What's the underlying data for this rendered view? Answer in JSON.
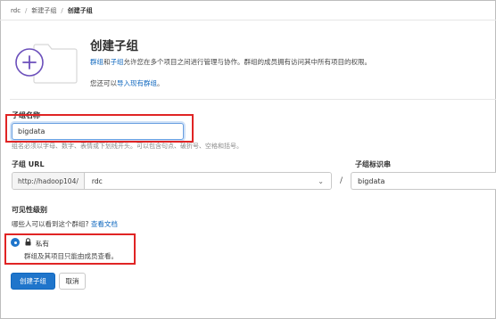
{
  "breadcrumb": {
    "items": [
      "rdc",
      "新建子组",
      "创建子组"
    ]
  },
  "header": {
    "title": "创建子组",
    "description_link1": "群组",
    "description_and": "和",
    "description_link2": "子组",
    "description_rest": "允许您在多个项目之间进行管理与协作。群组的成员拥有访问其中所有项目的权限。",
    "import_prefix": "您还可以",
    "import_link": "导入现有群组",
    "import_suffix": "。"
  },
  "form": {
    "name_label": "子组名称",
    "name_value": "bigdata",
    "name_hint": "组名必须以字母、数字、表情或下划线开头。可以包含句点、破折号、空格和括号。",
    "url_label": "子组 URL",
    "url_prefix": "http://hadoop104/",
    "url_parent": "rdc",
    "slash": "/",
    "slug_label": "子组标识串",
    "slug_value": "bigdata",
    "visibility_label": "可见性级别",
    "visibility_question": "哪些人可以看到这个群组?",
    "help_link": "查看文档",
    "private_label": "私有",
    "private_desc": "群组及其项目只能由成员查看。"
  },
  "actions": {
    "create_label": "创建子组",
    "cancel_label": "取消"
  },
  "icons": {
    "chevron": "chevron-down-icon",
    "lock": "lock-icon",
    "illustration": "folder-plus-illustration"
  },
  "colors": {
    "primary": "#1f75cb",
    "link": "#1068bf",
    "annotation": "#e02424",
    "illustration_accent": "#6b4fbb"
  }
}
